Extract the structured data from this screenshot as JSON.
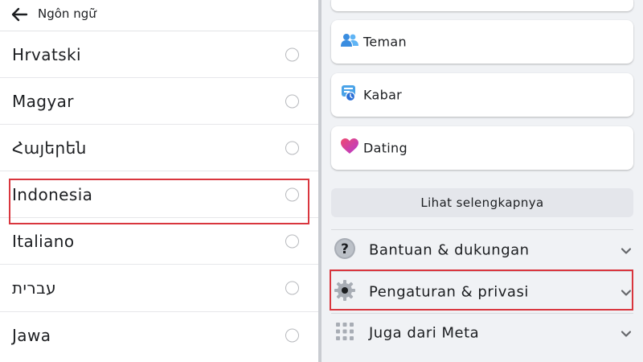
{
  "language_screen": {
    "header": {
      "back_icon": "arrow-left-icon",
      "title": "Ngôn ngữ"
    },
    "languages": [
      {
        "label": "Hrvatski",
        "selected": false
      },
      {
        "label": "Magyar",
        "selected": false
      },
      {
        "label": "Հայերեն",
        "selected": false
      },
      {
        "label": "Indonesia",
        "selected": false,
        "highlighted": true
      },
      {
        "label": "Italiano",
        "selected": false
      },
      {
        "label": "עברית",
        "selected": false
      },
      {
        "label": "Jawa",
        "selected": false
      }
    ]
  },
  "menu": {
    "shortcuts": [
      {
        "label": "Teman",
        "icon": "friends-icon"
      },
      {
        "label": "Kabar",
        "icon": "news-feed-icon"
      },
      {
        "label": "Dating",
        "icon": "dating-heart-icon"
      }
    ],
    "see_more_label": "Lihat selengkapnya",
    "sections": [
      {
        "label": "Bantuan & dukungan",
        "icon": "help-question-icon"
      },
      {
        "label": "Pengaturan & privasi",
        "icon": "settings-gear-icon",
        "highlighted": true
      },
      {
        "label": "Juga dari Meta",
        "icon": "grid-apps-icon"
      }
    ]
  },
  "colors": {
    "highlight_border": "#d9363e",
    "panel_background": "#f0f2f5",
    "button_gray": "#e4e6eb",
    "friends_blue": "#3a8de0",
    "dating_pink": "#e8418d"
  }
}
